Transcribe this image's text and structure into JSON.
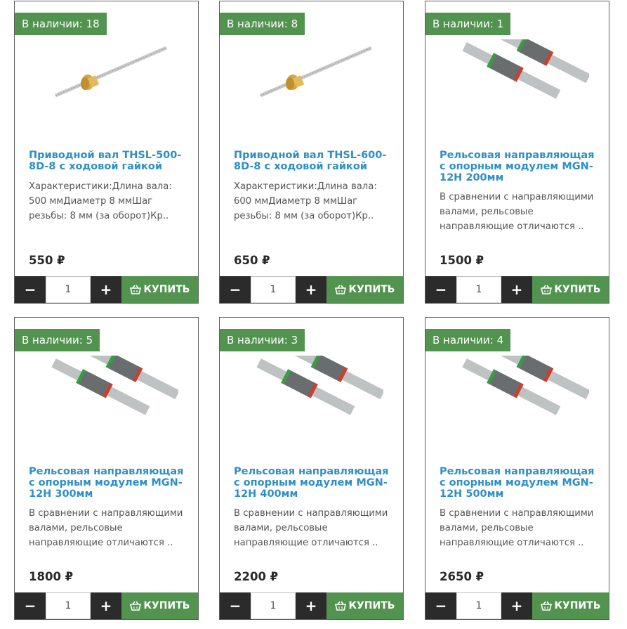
{
  "products": [
    {
      "stock": "В наличии: 18",
      "title": "Приводной вал THSL-500-8D-8 с ходовой гайкой",
      "desc": "Характеристики:Длина вала: 500 ммДиаметр 8 ммШаг резьбы: 8 мм (за оборот)Кр..",
      "price": "550 ₽",
      "qty": "1",
      "image": "lead-screw-image"
    },
    {
      "stock": "В наличии: 8",
      "title": "Приводной вал THSL-600-8D-8 с ходовой гайкой",
      "desc": "Характеристики:Длина вала: 600 ммДиаметр 8 ммШаг резьбы: 8 мм (за оборот)Кр..",
      "price": "650 ₽",
      "qty": "1",
      "image": "lead-screw-image"
    },
    {
      "stock": "В наличии: 1",
      "title": "Рельсовая направляющая с опорным модулем MGN-12H 200мм",
      "desc": "В сравнении с направляющими валами, рельсовые направляющие отличаются ..",
      "price": "1500 ₽",
      "qty": "1",
      "image": "linear-rail-image"
    },
    {
      "stock": "В наличии: 5",
      "title": "Рельсовая направляющая с опорным модулем MGN-12H 300мм",
      "desc": "В сравнении с направляющими валами, рельсовые направляющие отличаются ..",
      "price": "1800 ₽",
      "qty": "1",
      "image": "linear-rail-image"
    },
    {
      "stock": "В наличии: 3",
      "title": "Рельсовая направляющая с опорным модулем MGN-12H 400мм",
      "desc": "В сравнении с направляющими валами, рельсовые направляющие отличаются ..",
      "price": "2200 ₽",
      "qty": "1",
      "image": "linear-rail-image"
    },
    {
      "stock": "В наличии: 4",
      "title": "Рельсовая направляющая с опорным модулем MGN-12H 500мм",
      "desc": "В сравнении с направляющими валами, рельсовые направляющие отличаются ..",
      "price": "2650 ₽",
      "qty": "1",
      "image": "linear-rail-image"
    }
  ],
  "labels": {
    "minus": "−",
    "plus": "+",
    "buy": "КУПИТЬ",
    "buy_icon": "basket-icon"
  },
  "colors": {
    "accent_green": "#52934f",
    "title_blue": "#2f8fc5",
    "dark_button": "#2b2b2b"
  }
}
